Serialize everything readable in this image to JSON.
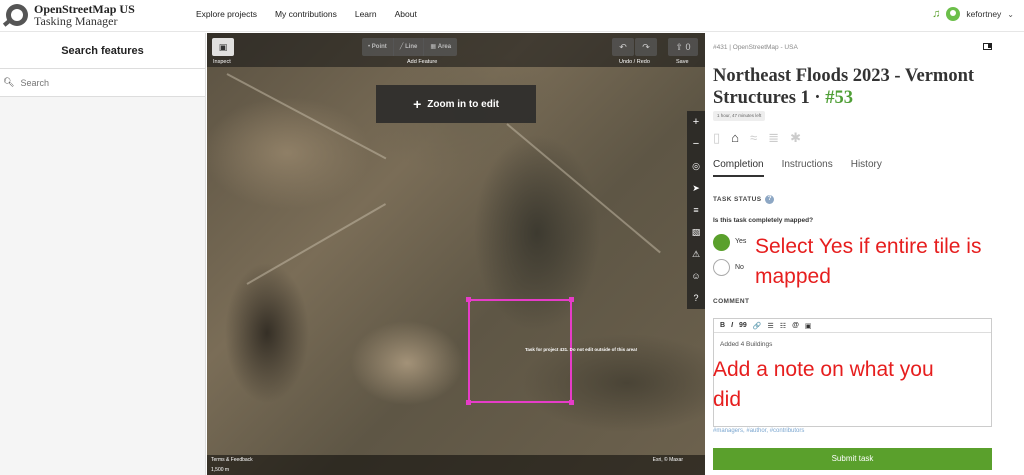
{
  "header": {
    "logo_line1": "OpenStreetMap US",
    "logo_line2": "Tasking Manager",
    "nav": [
      "Explore projects",
      "My contributions",
      "Learn",
      "About"
    ],
    "username": "kefortney",
    "bell_icon": "bell-icon"
  },
  "left_panel": {
    "title": "Search features",
    "search_placeholder": "Search"
  },
  "map": {
    "toolbar": {
      "inspect_label": "Inspect",
      "add_feature_label": "Add Feature",
      "point_label": "Point",
      "line_label": "Line",
      "area_label": "Area",
      "undo_redo_label": "Undo / Redo",
      "save_label": "Save",
      "save_count": "0"
    },
    "zoom_banner": "Zoom in to edit",
    "task_label": "Task for project 431. Do not edit outside of this area!",
    "terms": "Terms & Feedback",
    "scale": "1,500 m",
    "imagery_credit": "Esri, © Maxar"
  },
  "task_panel": {
    "breadcrumb": "#431 | OpenStreetMap - USA",
    "title": "Northeast Floods 2023 - Vermont Structures 1 · ",
    "task_number": "#53",
    "lock_badge": "1 hour, 47 minutes left",
    "tabs": [
      "Completion",
      "Instructions",
      "History"
    ],
    "task_status_label": "TASK STATUS",
    "question": "Is this task completely mapped?",
    "option_yes": "Yes",
    "option_no": "No",
    "selected": "Yes",
    "annotation_1": "Select Yes if entire tile is mapped",
    "comment_label": "COMMENT",
    "editor_tools": [
      "B",
      "I",
      "99",
      "🔗",
      "☰",
      "☷",
      "@",
      "▣"
    ],
    "comment_text": "Added 4 Buildings",
    "annotation_2": "Add a note on what you did",
    "tags_hint": "#managers, #author, #contributors",
    "submit_label": "Submit task"
  },
  "colors": {
    "accent_green": "#5aa02c",
    "annotation_red": "#e61e1e",
    "task_boundary": "#e63cc8"
  }
}
